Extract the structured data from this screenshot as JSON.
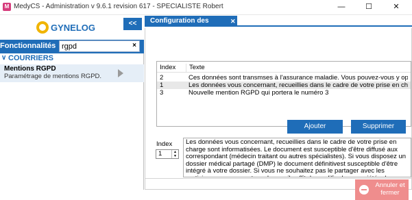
{
  "window": {
    "title": "MedyCS - Administration v 9.6.1 revision 617 - SPECIALISTE Robert",
    "minimize": "—",
    "maximize": "☐",
    "close": "✕"
  },
  "sidebar": {
    "logo": "GYNELOG",
    "collapse_label": "<<",
    "func_label": "Fonctionnalités",
    "search_value": "rgpd",
    "search_clear": "×",
    "group_label": "COURRIERS",
    "item_title": "Mentions RGPD",
    "item_desc": "Paramétrage de mentions RGPD."
  },
  "tab": {
    "label": "Configuration des mentions...",
    "close": "✕"
  },
  "grid": {
    "col_index": "Index",
    "col_text": "Texte",
    "rows": [
      {
        "index": "2",
        "text": "Ces données sont transmses  à l'assurance maladie. Vous pouvez-vous y opposer en ......"
      },
      {
        "index": "1",
        "text": "Les données vous concernant, recueillies dans le cadre de votre prise en charge sont informatisé..."
      },
      {
        "index": "3",
        "text": "Nouvelle mention RGPD qui portera le numéro 3"
      }
    ]
  },
  "buttons": {
    "add": "Ajouter",
    "delete": "Supprimer",
    "cancel": "Annuler et fermer"
  },
  "detail": {
    "index_label": "Index",
    "index_value": "1",
    "text": "Les données vous concernant, recueillies dans le cadre de votre prise en charge sont informatisées. Le document est susceptible d'être diffusé aux correspondant (médecin traitant ou autres spécialistes). Si vous disposez un dossier médical partagé (DMP) le document définitivest susceptible d'être intégré à votre dossier. Si vous ne souhaitez pas le partager avec les praticiens vous prenant en charge, il suffit de modifier les propriétés dans votre DMP. Pour plus d'information ou pour accéder"
  },
  "colors": {
    "accent": "#1f6db8",
    "cancel": "#ef8d8d",
    "selected_row": "#e5eef7"
  }
}
